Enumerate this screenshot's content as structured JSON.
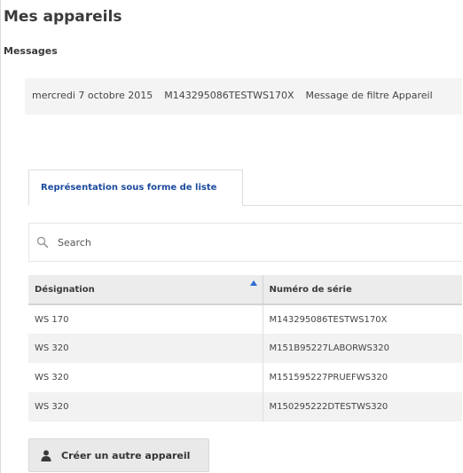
{
  "page": {
    "title": "Mes appareils"
  },
  "messages": {
    "section_title": "Messages",
    "items": [
      {
        "date": "mercredi 7 octobre 2015",
        "serial": "M143295086TESTWS170X",
        "text": "Message de filtre Appareil"
      }
    ]
  },
  "tabs": [
    {
      "label": "Représentation sous forme de liste",
      "active": true
    }
  ],
  "search": {
    "placeholder": "Search",
    "value": "",
    "icon": "search-icon"
  },
  "table": {
    "columns": [
      {
        "label": "Désignation",
        "sorted": "ascending",
        "sort_icon": "sort-up-icon"
      },
      {
        "label": "Numéro de série"
      }
    ],
    "rows": [
      {
        "designation": "WS 170",
        "serial": "M143295086TESTWS170X"
      },
      {
        "designation": "WS 320",
        "serial": "M151B95227LABORWS320"
      },
      {
        "designation": "WS 320",
        "serial": "M151595227PRUEFWS320"
      },
      {
        "designation": "WS 320",
        "serial": "M150295222DTESTWS320"
      }
    ]
  },
  "actions": {
    "create_label": "Créer un autre appareil",
    "create_icon": "user-icon"
  },
  "colors": {
    "tab_label": "#1a4a9c",
    "sort_arrow": "#2a6bd1",
    "header_bg": "#ececec",
    "stripe_bg": "#f2f2f2",
    "message_bg": "#f4f4f4"
  }
}
